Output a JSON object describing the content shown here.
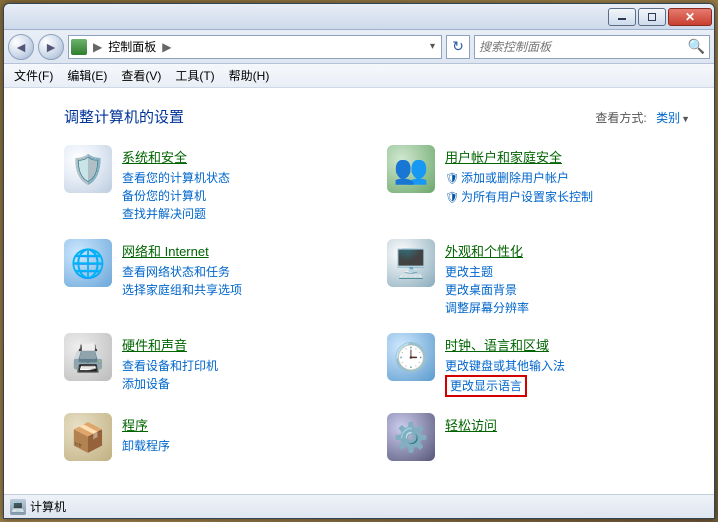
{
  "titlebar": {
    "empty": ""
  },
  "nav": {
    "location": "控制面板",
    "sep": "▶"
  },
  "search": {
    "placeholder": "搜索控制面板"
  },
  "menu": {
    "file": "文件(F)",
    "edit": "编辑(E)",
    "view": "查看(V)",
    "tools": "工具(T)",
    "help": "帮助(H)"
  },
  "heading": "调整计算机的设置",
  "viewby": {
    "label": "查看方式:",
    "value": "类别"
  },
  "cats": {
    "security": {
      "title": "系统和安全",
      "links": [
        "查看您的计算机状态",
        "备份您的计算机",
        "查找并解决问题"
      ]
    },
    "users": {
      "title": "用户帐户和家庭安全",
      "links": [
        "添加或删除用户帐户",
        "为所有用户设置家长控制"
      ]
    },
    "network": {
      "title": "网络和 Internet",
      "links": [
        "查看网络状态和任务",
        "选择家庭组和共享选项"
      ]
    },
    "appearance": {
      "title": "外观和个性化",
      "links": [
        "更改主题",
        "更改桌面背景",
        "调整屏幕分辨率"
      ]
    },
    "hardware": {
      "title": "硬件和声音",
      "links": [
        "查看设备和打印机",
        "添加设备"
      ]
    },
    "clock": {
      "title": "时钟、语言和区域",
      "links": [
        "更改键盘或其他输入法",
        "更改显示语言"
      ]
    },
    "programs": {
      "title": "程序",
      "links": [
        "卸载程序"
      ]
    },
    "ease": {
      "title": "轻松访问",
      "links": []
    }
  },
  "status": {
    "label": "计算机"
  }
}
